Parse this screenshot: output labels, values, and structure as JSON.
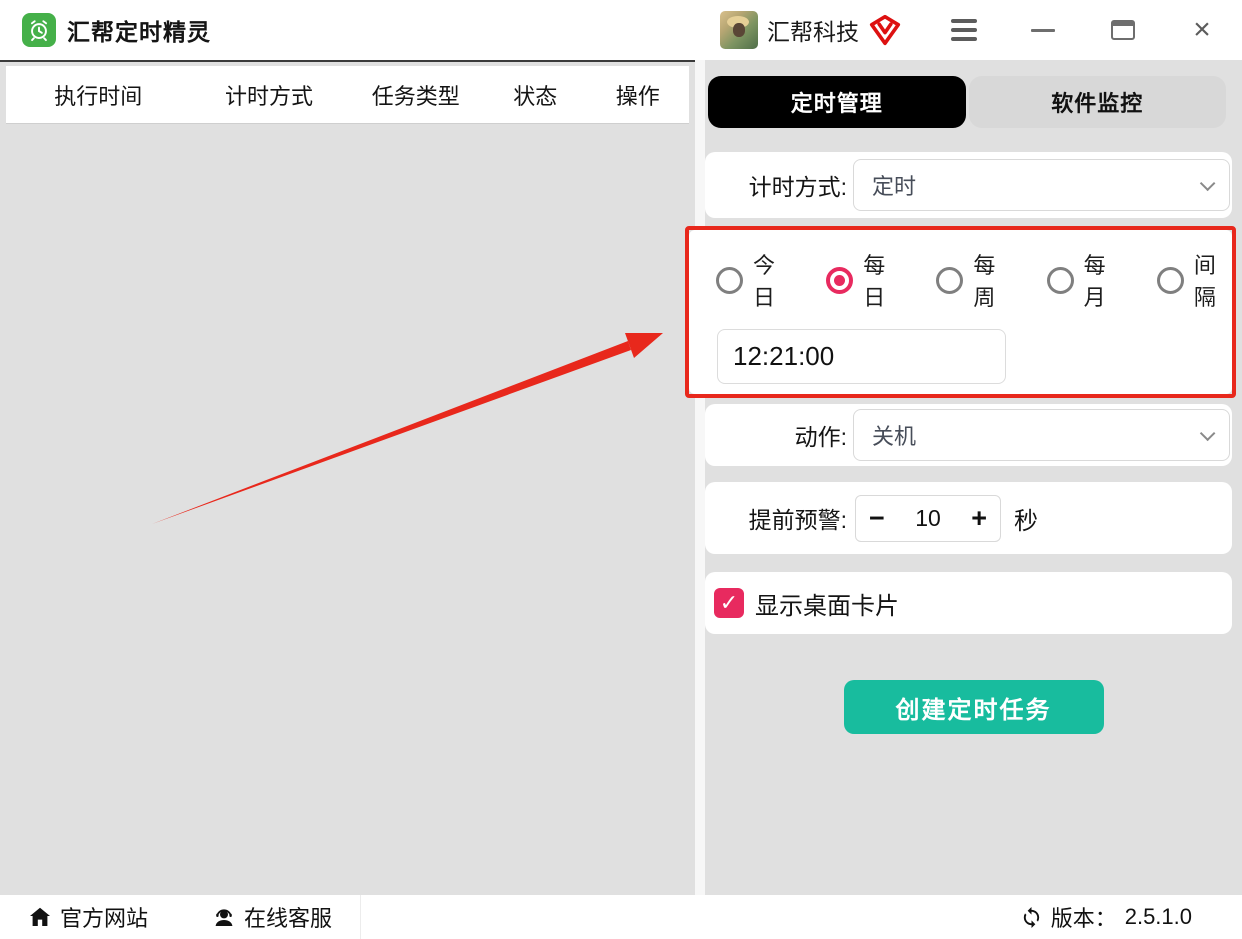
{
  "title_bar": {
    "app_title": "汇帮定时精灵",
    "app_icon": "alarm-clock-icon",
    "account_name": "汇帮科技",
    "badge_icon": "vip-shield-icon",
    "controls": {
      "menu_icon": "hamburger-icon",
      "minimize_icon": "minimize-icon",
      "maximize_icon": "maximize-icon",
      "close_glyph": "×"
    }
  },
  "task_table": {
    "headers": [
      "执行时间",
      "计时方式",
      "任务类型",
      "状态",
      "操作"
    ],
    "rows": []
  },
  "tabs": [
    {
      "label": "定时管理",
      "active": true
    },
    {
      "label": "软件监控",
      "active": false
    }
  ],
  "form": {
    "timing_mode": {
      "label": "计时方式:",
      "value": "定时"
    },
    "schedule": {
      "options": [
        {
          "label": "今日",
          "selected": false
        },
        {
          "label": "每日",
          "selected": true
        },
        {
          "label": "每周",
          "selected": false
        },
        {
          "label": "每月",
          "selected": false
        },
        {
          "label": "间隔",
          "selected": false
        }
      ],
      "time_value": "12:21:00"
    },
    "action": {
      "label": "动作:",
      "value": "关机"
    },
    "warning": {
      "label": "提前预警:",
      "minus": "−",
      "value": "10",
      "plus": "+",
      "unit": "秒"
    },
    "desktop_card": {
      "label": "显示桌面卡片",
      "checked": true
    },
    "submit_label": "创建定时任务"
  },
  "footer": {
    "website_label": "官方网站",
    "support_label": "在线客服",
    "version_label": "版本：",
    "version_value": "2.5.1.0"
  },
  "colors": {
    "accent_pink": "#e82a5f",
    "button_teal": "#18bc9e",
    "annotation_red": "#e8281c",
    "tab_active_bg": "#000000",
    "app_icon_green": "#45b049",
    "panel_gray": "#e0e0e0"
  }
}
